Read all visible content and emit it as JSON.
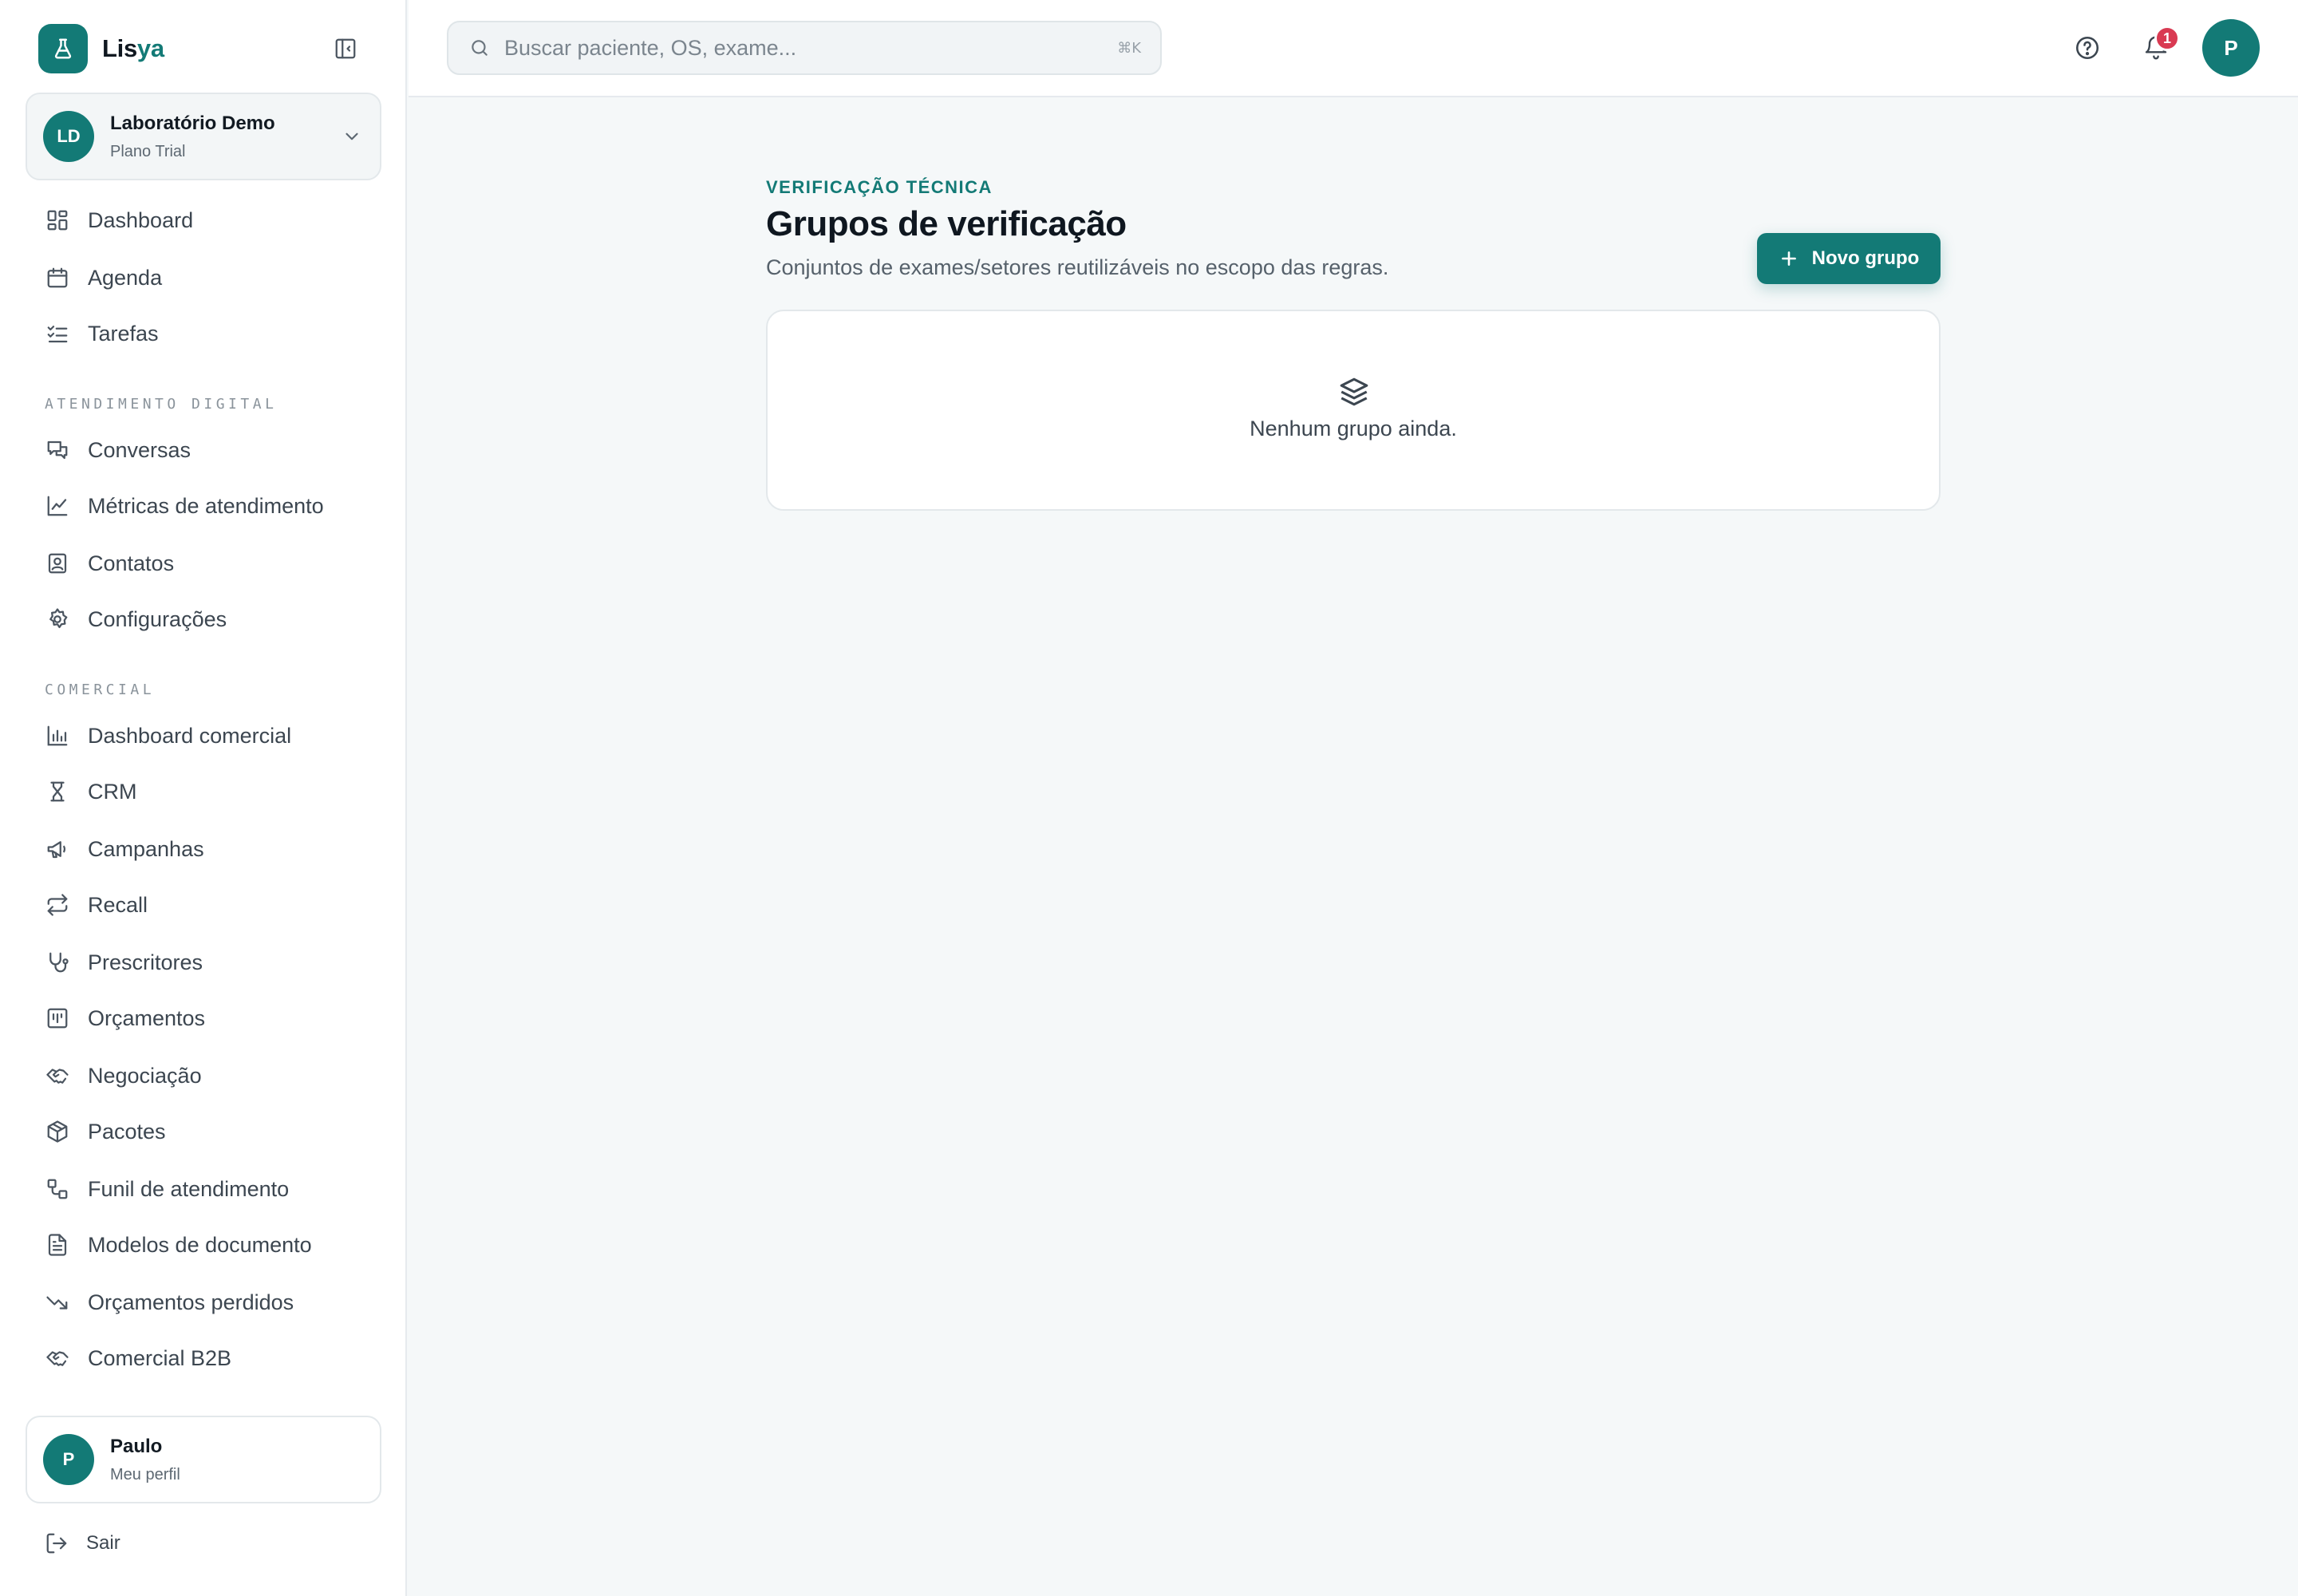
{
  "brand": {
    "name_main": "Lis",
    "name_accent": "ya"
  },
  "organization": {
    "initials": "LD",
    "name": "Laboratório Demo",
    "plan": "Plano Trial"
  },
  "nav": {
    "main": [
      {
        "label": "Dashboard",
        "icon": "dashboard-icon"
      },
      {
        "label": "Agenda",
        "icon": "calendar-icon"
      },
      {
        "label": "Tarefas",
        "icon": "checklist-icon"
      }
    ],
    "sections": [
      {
        "title": "ATENDIMENTO DIGITAL",
        "items": [
          {
            "label": "Conversas",
            "icon": "chat-icon"
          },
          {
            "label": "Métricas de atendimento",
            "icon": "line-chart-icon"
          },
          {
            "label": "Contatos",
            "icon": "contact-icon"
          },
          {
            "label": "Configurações",
            "icon": "gear-icon"
          }
        ]
      },
      {
        "title": "COMERCIAL",
        "items": [
          {
            "label": "Dashboard comercial",
            "icon": "bar-chart-icon"
          },
          {
            "label": "CRM",
            "icon": "crm-icon"
          },
          {
            "label": "Campanhas",
            "icon": "megaphone-icon"
          },
          {
            "label": "Recall",
            "icon": "repeat-icon"
          },
          {
            "label": "Prescritores",
            "icon": "stethoscope-icon"
          },
          {
            "label": "Orçamentos",
            "icon": "budget-icon"
          },
          {
            "label": "Negociação",
            "icon": "handshake-icon"
          },
          {
            "label": "Pacotes",
            "icon": "package-icon"
          },
          {
            "label": "Funil de atendimento",
            "icon": "funnel-icon"
          },
          {
            "label": "Modelos de documento",
            "icon": "document-icon"
          },
          {
            "label": "Orçamentos perdidos",
            "icon": "trending-down-icon"
          },
          {
            "label": "Comercial B2B",
            "icon": "handshake-icon"
          }
        ]
      }
    ]
  },
  "profile": {
    "initial": "P",
    "name": "Paulo",
    "subtitle": "Meu perfil"
  },
  "logout_label": "Sair",
  "search": {
    "placeholder": "Buscar paciente, OS, exame...",
    "shortcut": "⌘K"
  },
  "notifications": {
    "count": "1"
  },
  "user_avatar_initial": "P",
  "page": {
    "eyebrow": "VERIFICAÇÃO TÉCNICA",
    "title": "Grupos de verificação",
    "subtitle": "Conjuntos de exames/setores reutilizáveis no escopo das regras.",
    "new_button_label": "Novo grupo",
    "empty_message": "Nenhum grupo ainda."
  },
  "colors": {
    "accent": "#137a76",
    "badge": "#d93a52",
    "background": "#f5f8f9"
  }
}
